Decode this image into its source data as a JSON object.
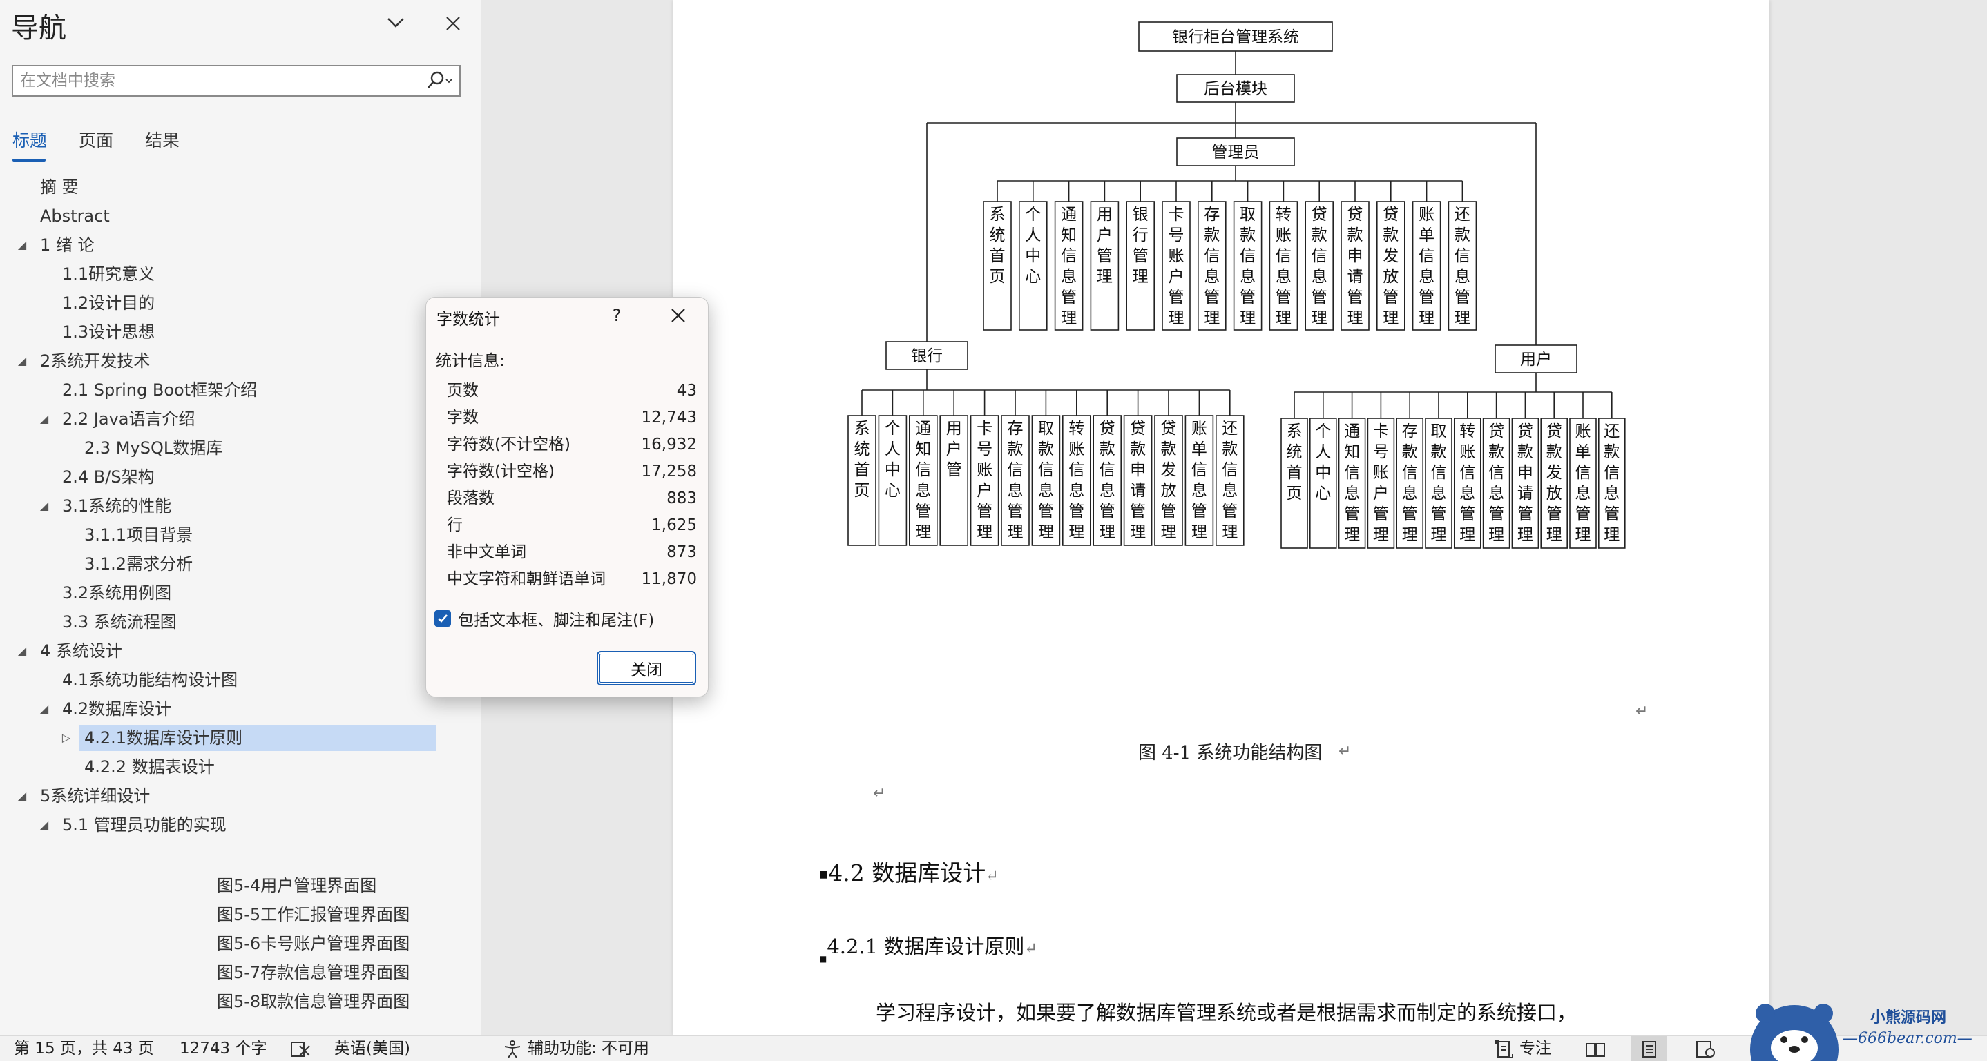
{
  "nav": {
    "title": "导航",
    "search_placeholder": "在文档中搜索",
    "tabs": [
      "标题",
      "页面",
      "结果"
    ],
    "headings": [
      {
        "label": "摘  要",
        "level": 1,
        "tri": ""
      },
      {
        "label": "Abstract",
        "level": 1,
        "tri": ""
      },
      {
        "label": "1 绪  论",
        "level": 1,
        "tri": "◢"
      },
      {
        "label": "1.1研究意义",
        "level": 2,
        "tri": ""
      },
      {
        "label": "1.2设计目的",
        "level": 2,
        "tri": ""
      },
      {
        "label": "1.3设计思想",
        "level": 2,
        "tri": ""
      },
      {
        "label": "2系统开发技术",
        "level": 1,
        "tri": "◢"
      },
      {
        "label": "2.1 Spring Boot框架介绍",
        "level": 2,
        "tri": ""
      },
      {
        "label": "2.2 Java语言介绍",
        "level": 2,
        "tri": "◢"
      },
      {
        "label": "2.3 MySQL数据库",
        "level": 3,
        "tri": ""
      },
      {
        "label": "2.4 B/S架构",
        "level": 2,
        "tri": ""
      },
      {
        "label": "3.1系统的性能",
        "level": 2,
        "tri": "◢"
      },
      {
        "label": "3.1.1项目背景",
        "level": 3,
        "tri": ""
      },
      {
        "label": "3.1.2需求分析",
        "level": 3,
        "tri": ""
      },
      {
        "label": "3.2系统用例图",
        "level": 2,
        "tri": ""
      },
      {
        "label": "3.3 系统流程图",
        "level": 2,
        "tri": ""
      },
      {
        "label": "4 系统设计",
        "level": 1,
        "tri": "◢"
      },
      {
        "label": "4.1系统功能结构设计图",
        "level": 2,
        "tri": ""
      },
      {
        "label": "4.2数据库设计",
        "level": 2,
        "tri": "◢"
      },
      {
        "label": "4.2.1数据库设计原则",
        "level": 3,
        "tri": "▷",
        "selected": true
      },
      {
        "label": "4.2.2  数据表设计",
        "level": 3,
        "tri": ""
      },
      {
        "label": "5系统详细设计",
        "level": 1,
        "tri": "◢"
      },
      {
        "label": "5.1 管理员功能的实现",
        "level": 2,
        "tri": "◢"
      }
    ],
    "figures": [
      "图5-4用户管理界面图",
      "图5-5工作汇报管理界面图",
      "图5-6卡号账户管理界面图",
      "图5-7存款信息管理界面图",
      "图5-8取款信息管理界面图"
    ]
  },
  "dialog": {
    "title": "字数统计",
    "help": "?",
    "stats_label": "统计信息:",
    "rows": [
      {
        "label": "页数",
        "value": "43"
      },
      {
        "label": "字数",
        "value": "12,743"
      },
      {
        "label": "字符数(不计空格)",
        "value": "16,932"
      },
      {
        "label": "字符数(计空格)",
        "value": "17,258"
      },
      {
        "label": "段落数",
        "value": "883"
      },
      {
        "label": "行",
        "value": "1,625"
      },
      {
        "label": "非中文单词",
        "value": "873"
      },
      {
        "label": "中文字符和朝鲜语单词",
        "value": "11,870"
      }
    ],
    "checkbox_label": "包括文本框、脚注和尾注(F)",
    "checkbox_checked": true,
    "close_label": "关闭"
  },
  "document": {
    "diagram": {
      "root": "银行柜台管理系统",
      "module": "后台模块",
      "admin": "管理员",
      "admin_items": [
        "系统首页",
        "个人中心",
        "通知信息管理",
        "用户管理",
        "银行管理",
        "卡号账户管理",
        "存款信息管理",
        "取款信息管理",
        "转账信息管理",
        "贷款信息管理",
        "贷款申请管理",
        "贷款发放管理",
        "账单信息管理",
        "还款信息管理"
      ],
      "bank": "银行",
      "bank_items": [
        "系统首页",
        "个人中心",
        "通知信息管理",
        "用户管",
        "卡号账户管理",
        "存款信息管理",
        "取款信息管理",
        "转账信息管理",
        "贷款信息管理",
        "贷款申请管理",
        "贷款发放管理",
        "账单信息管理",
        "还款信息管理"
      ],
      "user": "用户",
      "user_items": [
        "系统首页",
        "个人中心",
        "通知信息管理",
        "卡号账户管理",
        "存款信息管理",
        "取款信息管理",
        "转账信息管理",
        "贷款信息管理",
        "贷款申请管理",
        "贷款发放管理",
        "账单信息管理",
        "还款信息管理"
      ]
    },
    "caption": "图 4-1 系统功能结构图",
    "para_mark": "↵",
    "heading2": "4.2 数据库设计",
    "heading3": "4.2.1 数据库设计原则",
    "body": "学习程序设计，如果要了解数据库管理系统或者是根据需求而制定的系统接口，"
  },
  "status": {
    "page": "第 15 页，共 43 页",
    "words": "12743 个字",
    "language": "英语(美国)",
    "accessibility": "辅助功能: 不可用",
    "focus": "专注"
  },
  "watermark": {
    "title": "小熊源码网",
    "url": "—666bear.com—"
  }
}
